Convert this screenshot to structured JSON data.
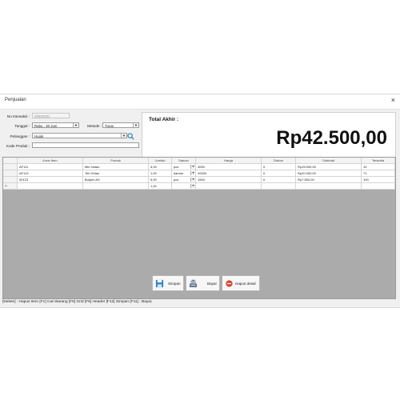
{
  "window": {
    "title": "Penjualan",
    "close_glyph": "×"
  },
  "form": {
    "no_transaksi_label": "No transaksi :",
    "no_transaksi_value": "00000001",
    "tanggal_label": "Tanggal :",
    "tanggal_value": "Rabu , 30   Juni",
    "metode_label": "Metode :",
    "metode_value": "Tunai",
    "pelanggan_label": "Pelanggan :",
    "pelanggan_value": "Hugik",
    "kode_produk_label": "Kode Produk :",
    "kode_produk_value": ""
  },
  "total": {
    "label": "Total Akhir :",
    "value": "Rp42.500,00"
  },
  "grid": {
    "headers": [
      "Kode Item",
      "Produk",
      "Jumlah",
      "Satuan",
      "Harga",
      "Diskon",
      "Subtotal",
      "Tersedia"
    ],
    "rows": [
      {
        "kode": "AF111",
        "produk": "Mie Instan",
        "jumlah": "5,00",
        "satuan": "pcs",
        "harga": "3000",
        "diskon": "0",
        "subtotal": "Rp15.000,00",
        "tersedia": "10"
      },
      {
        "kode": "AF113",
        "produk": "Teh Gelas",
        "jumlah": "1,00",
        "satuan": "kardus",
        "harga": "20000",
        "diskon": "0",
        "subtotal": "Rp20.000,00",
        "tersedia": "71"
      },
      {
        "kode": "00123",
        "produk": "Bulpen AS",
        "jumlah": "5,00",
        "satuan": "pcs",
        "harga": "1500",
        "diskon": "0",
        "subtotal": "Rp7.500,00",
        "tersedia": "100"
      }
    ],
    "new_row": {
      "marker": "**",
      "jumlah": "1,00"
    }
  },
  "buttons": {
    "simpan": "Simpan",
    "bayar": "Bayar",
    "hapus_detail": "Hapus detail"
  },
  "status": {
    "shortcuts": "[Delete] : Hapus Item   [F1] Cari Barang  [F5] Grid  [F6] Header  [F12] Simpan  [F11] : Bayar,"
  },
  "colors": {
    "accent_blue": "#2f7fc0",
    "delete_red": "#d9412f"
  }
}
